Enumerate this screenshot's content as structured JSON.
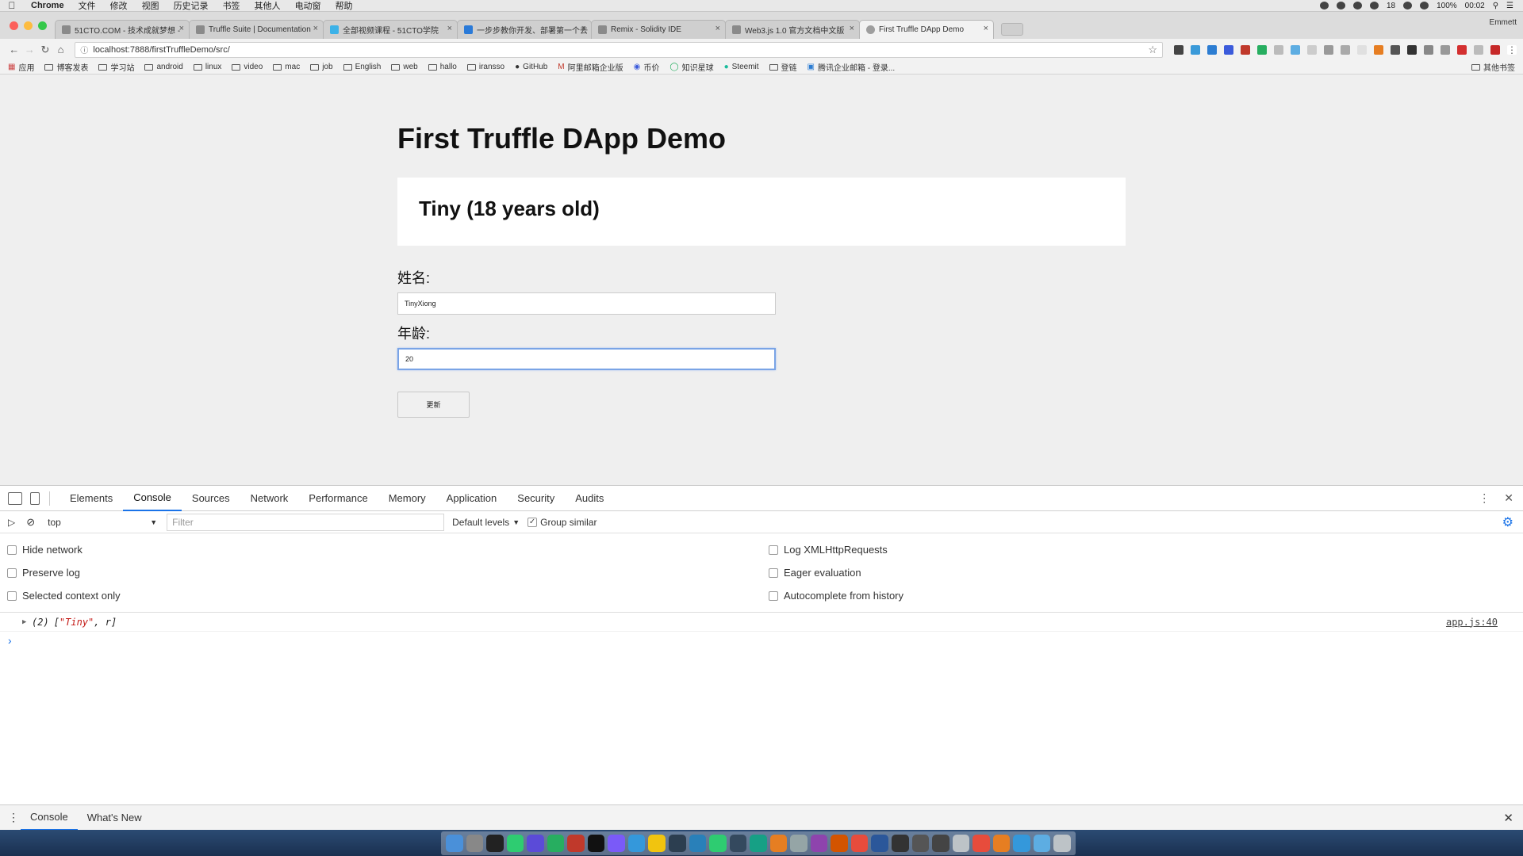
{
  "menubar": {
    "app": "Chrome",
    "items": [
      "文件",
      "修改",
      "视图",
      "历史记录",
      "书签",
      "其他人",
      "电动窗",
      "帮助"
    ],
    "status": {
      "battery": "100%",
      "time": "00:02",
      "count": "18"
    }
  },
  "tabs": [
    {
      "title": "51CTO.COM - 技术成就梦想 -"
    },
    {
      "title": "Truffle Suite | Documentation"
    },
    {
      "title": "全部视频课程 - 51CTO学院"
    },
    {
      "title": "一步步教你开发、部署第一个去"
    },
    {
      "title": "Remix - Solidity IDE"
    },
    {
      "title": "Web3.js 1.0 官方文档中文版"
    },
    {
      "title": "First Truffle DApp Demo",
      "active": true
    }
  ],
  "profile": "Emmett",
  "address": "localhost:7888/firstTruffleDemo/src/",
  "bookmarks": [
    "应用",
    "博客发表",
    "学习站",
    "android",
    "linux",
    "video",
    "mac",
    "job",
    "English",
    "web",
    "hallo",
    "iransso",
    "GitHub",
    "阿里邮箱企业版",
    "币价",
    "知识星球",
    "Steemit",
    "登链",
    "腾讯企业邮箱 - 登录..."
  ],
  "bookmarks_other": "其他书签",
  "page": {
    "title": "First Truffle DApp Demo",
    "card_text": "Tiny (18 years old)",
    "name_label": "姓名:",
    "name_value": "TinyXiong",
    "age_label": "年龄:",
    "age_value": "20",
    "update_button": "更新"
  },
  "devtools": {
    "tabs": [
      "Elements",
      "Console",
      "Sources",
      "Network",
      "Performance",
      "Memory",
      "Application",
      "Security",
      "Audits"
    ],
    "active_tab": "Console",
    "context": "top",
    "filter_placeholder": "Filter",
    "levels": "Default levels",
    "group_similar": "Group similar",
    "settings_left": [
      "Hide network",
      "Preserve log",
      "Selected context only"
    ],
    "settings_right": [
      "Log XMLHttpRequests",
      "Eager evaluation",
      "Autocomplete from history"
    ],
    "console": {
      "count": "(2)",
      "str1": "\"Tiny\"",
      "rest": ", r]",
      "source": "app.js:40"
    },
    "drawer_tabs": [
      "Console",
      "What's New"
    ]
  },
  "colors": {
    "accent": "#1a73e8",
    "focus_border": "#7aa4e6",
    "page_bg": "#efefef"
  }
}
